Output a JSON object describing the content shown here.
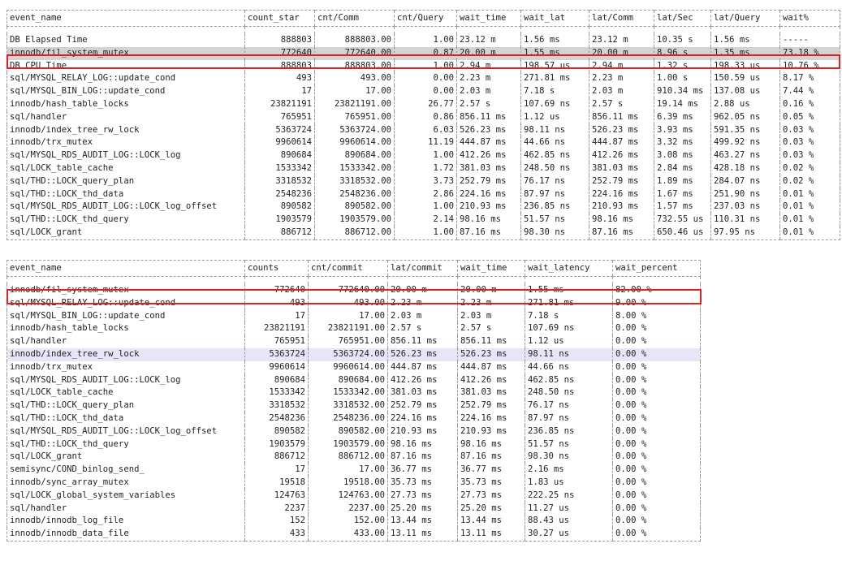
{
  "table1": {
    "headers": [
      "event_name",
      "count_star",
      "cnt/Comm",
      "cnt/Query",
      "wait_time",
      "wait_lat",
      "lat/Comm",
      "lat/Sec",
      "lat/Query",
      "wait%"
    ],
    "rows": [
      [
        "DB Elapsed Time",
        "888803",
        "888803.00",
        "1.00",
        "23.12 m",
        "1.56 ms",
        "23.12 m",
        "10.35 s",
        "1.56 ms",
        "-----"
      ],
      [
        "innodb/fil_system_mutex",
        "772640",
        "772640.00",
        "0.87",
        "20.00 m",
        "1.55 ms",
        "20.00 m",
        "8.96 s",
        "1.35 ms",
        "73.18 %"
      ],
      [
        "DB CPU Time",
        "888803",
        "888803.00",
        "1.00",
        "2.94 m",
        "198.57 us",
        "2.94 m",
        "1.32 s",
        "198.33 us",
        "10.76 %"
      ],
      [
        "sql/MYSQL_RELAY_LOG::update_cond",
        "493",
        "493.00",
        "0.00",
        "2.23 m",
        "271.81 ms",
        "2.23 m",
        "1.00 s",
        "150.59 us",
        "8.17 %"
      ],
      [
        "sql/MYSQL_BIN_LOG::update_cond",
        "17",
        "17.00",
        "0.00",
        "2.03 m",
        "7.18 s",
        "2.03 m",
        "910.34 ms",
        "137.08 us",
        "7.44 %"
      ],
      [
        "innodb/hash_table_locks",
        "23821191",
        "23821191.00",
        "26.77",
        "2.57 s",
        "107.69 ns",
        "2.57 s",
        "19.14 ms",
        "2.88 us",
        "0.16 %"
      ],
      [
        "sql/handler",
        "765951",
        "765951.00",
        "0.86",
        "856.11 ms",
        "1.12 us",
        "856.11 ms",
        "6.39 ms",
        "962.05 ns",
        "0.05 %"
      ],
      [
        "innodb/index_tree_rw_lock",
        "5363724",
        "5363724.00",
        "6.03",
        "526.23 ms",
        "98.11 ns",
        "526.23 ms",
        "3.93 ms",
        "591.35 ns",
        "0.03 %"
      ],
      [
        "innodb/trx_mutex",
        "9960614",
        "9960614.00",
        "11.19",
        "444.87 ms",
        "44.66 ns",
        "444.87 ms",
        "3.32 ms",
        "499.92 ns",
        "0.03 %"
      ],
      [
        "sql/MYSQL_RDS_AUDIT_LOG::LOCK_log",
        "890684",
        "890684.00",
        "1.00",
        "412.26 ms",
        "462.85 ns",
        "412.26 ms",
        "3.08 ms",
        "463.27 ns",
        "0.03 %"
      ],
      [
        "sql/LOCK_table_cache",
        "1533342",
        "1533342.00",
        "1.72",
        "381.03 ms",
        "248.50 ns",
        "381.03 ms",
        "2.84 ms",
        "428.18 ns",
        "0.02 %"
      ],
      [
        "sql/THD::LOCK_query_plan",
        "3318532",
        "3318532.00",
        "3.73",
        "252.79 ms",
        "76.17 ns",
        "252.79 ms",
        "1.89 ms",
        "284.07 ns",
        "0.02 %"
      ],
      [
        "sql/THD::LOCK_thd_data",
        "2548236",
        "2548236.00",
        "2.86",
        "224.16 ms",
        "87.97 ns",
        "224.16 ms",
        "1.67 ms",
        "251.90 ns",
        "0.01 %"
      ],
      [
        "sql/MYSQL_RDS_AUDIT_LOG::LOCK_log_offset",
        "890582",
        "890582.00",
        "1.00",
        "210.93 ms",
        "236.85 ns",
        "210.93 ms",
        "1.57 ms",
        "237.03 ns",
        "0.01 %"
      ],
      [
        "sql/THD::LOCK_thd_query",
        "1903579",
        "1903579.00",
        "2.14",
        "98.16 ms",
        "51.57 ns",
        "98.16 ms",
        "732.55 us",
        "110.31 ns",
        "0.01 %"
      ],
      [
        "sql/LOCK_grant",
        "886712",
        "886712.00",
        "1.00",
        "87.16 ms",
        "98.30 ns",
        "87.16 ms",
        "650.46 us",
        "97.95 ns",
        "0.01 %"
      ]
    ]
  },
  "table2": {
    "headers": [
      "event_name",
      "counts",
      "cnt/commit",
      "lat/commit",
      "wait_time",
      "wait_latency",
      "wait_percent"
    ],
    "rows": [
      [
        "innodb/fil_system_mutex",
        "772640",
        "772640.00",
        "20.00 m",
        "20.00 m",
        "1.55 ms",
        "82.00 %"
      ],
      [
        "sql/MYSQL_RELAY_LOG::update_cond",
        "493",
        "493.00",
        "2.23 m",
        "2.23 m",
        "271.81 ms",
        "9.00 %"
      ],
      [
        "sql/MYSQL_BIN_LOG::update_cond",
        "17",
        "17.00",
        "2.03 m",
        "2.03 m",
        "7.18 s",
        "8.00 %"
      ],
      [
        "innodb/hash_table_locks",
        "23821191",
        "23821191.00",
        "2.57 s",
        "2.57 s",
        "107.69 ns",
        "0.00 %"
      ],
      [
        "sql/handler",
        "765951",
        "765951.00",
        "856.11 ms",
        "856.11 ms",
        "1.12 us",
        "0.00 %"
      ],
      [
        "innodb/index_tree_rw_lock",
        "5363724",
        "5363724.00",
        "526.23 ms",
        "526.23 ms",
        "98.11 ns",
        "0.00 %"
      ],
      [
        "innodb/trx_mutex",
        "9960614",
        "9960614.00",
        "444.87 ms",
        "444.87 ms",
        "44.66 ns",
        "0.00 %"
      ],
      [
        "sql/MYSQL_RDS_AUDIT_LOG::LOCK_log",
        "890684",
        "890684.00",
        "412.26 ms",
        "412.26 ms",
        "462.85 ns",
        "0.00 %"
      ],
      [
        "sql/LOCK_table_cache",
        "1533342",
        "1533342.00",
        "381.03 ms",
        "381.03 ms",
        "248.50 ns",
        "0.00 %"
      ],
      [
        "sql/THD::LOCK_query_plan",
        "3318532",
        "3318532.00",
        "252.79 ms",
        "252.79 ms",
        "76.17 ns",
        "0.00 %"
      ],
      [
        "sql/THD::LOCK_thd_data",
        "2548236",
        "2548236.00",
        "224.16 ms",
        "224.16 ms",
        "87.97 ns",
        "0.00 %"
      ],
      [
        "sql/MYSQL_RDS_AUDIT_LOG::LOCK_log_offset",
        "890582",
        "890582.00",
        "210.93 ms",
        "210.93 ms",
        "236.85 ns",
        "0.00 %"
      ],
      [
        "sql/THD::LOCK_thd_query",
        "1903579",
        "1903579.00",
        "98.16 ms",
        "98.16 ms",
        "51.57 ns",
        "0.00 %"
      ],
      [
        "sql/LOCK_grant",
        "886712",
        "886712.00",
        "87.16 ms",
        "87.16 ms",
        "98.30 ns",
        "0.00 %"
      ],
      [
        "semisync/COND_binlog_send_",
        "17",
        "17.00",
        "36.77 ms",
        "36.77 ms",
        "2.16 ms",
        "0.00 %"
      ],
      [
        "innodb/sync_array_mutex",
        "19518",
        "19518.00",
        "35.73 ms",
        "35.73 ms",
        "1.83 us",
        "0.00 %"
      ],
      [
        "sql/LOCK_global_system_variables",
        "124763",
        "124763.00",
        "27.73 ms",
        "27.73 ms",
        "222.25 ns",
        "0.00 %"
      ],
      [
        "sql/handler",
        "2237",
        "2237.00",
        "25.20 ms",
        "25.20 ms",
        "11.27 us",
        "0.00 %"
      ],
      [
        "innodb/innodb_log_file",
        "152",
        "152.00",
        "13.44 ms",
        "13.44 ms",
        "88.43 us",
        "0.00 %"
      ],
      [
        "innodb/innodb_data_file",
        "433",
        "433.00",
        "13.11 ms",
        "13.11 ms",
        "30.27 us",
        "0.00 %"
      ]
    ]
  },
  "colors": {
    "highlight_border": "#e02020",
    "selected_row": "#d3d3d3",
    "hover_row": "#e6e6f6"
  }
}
